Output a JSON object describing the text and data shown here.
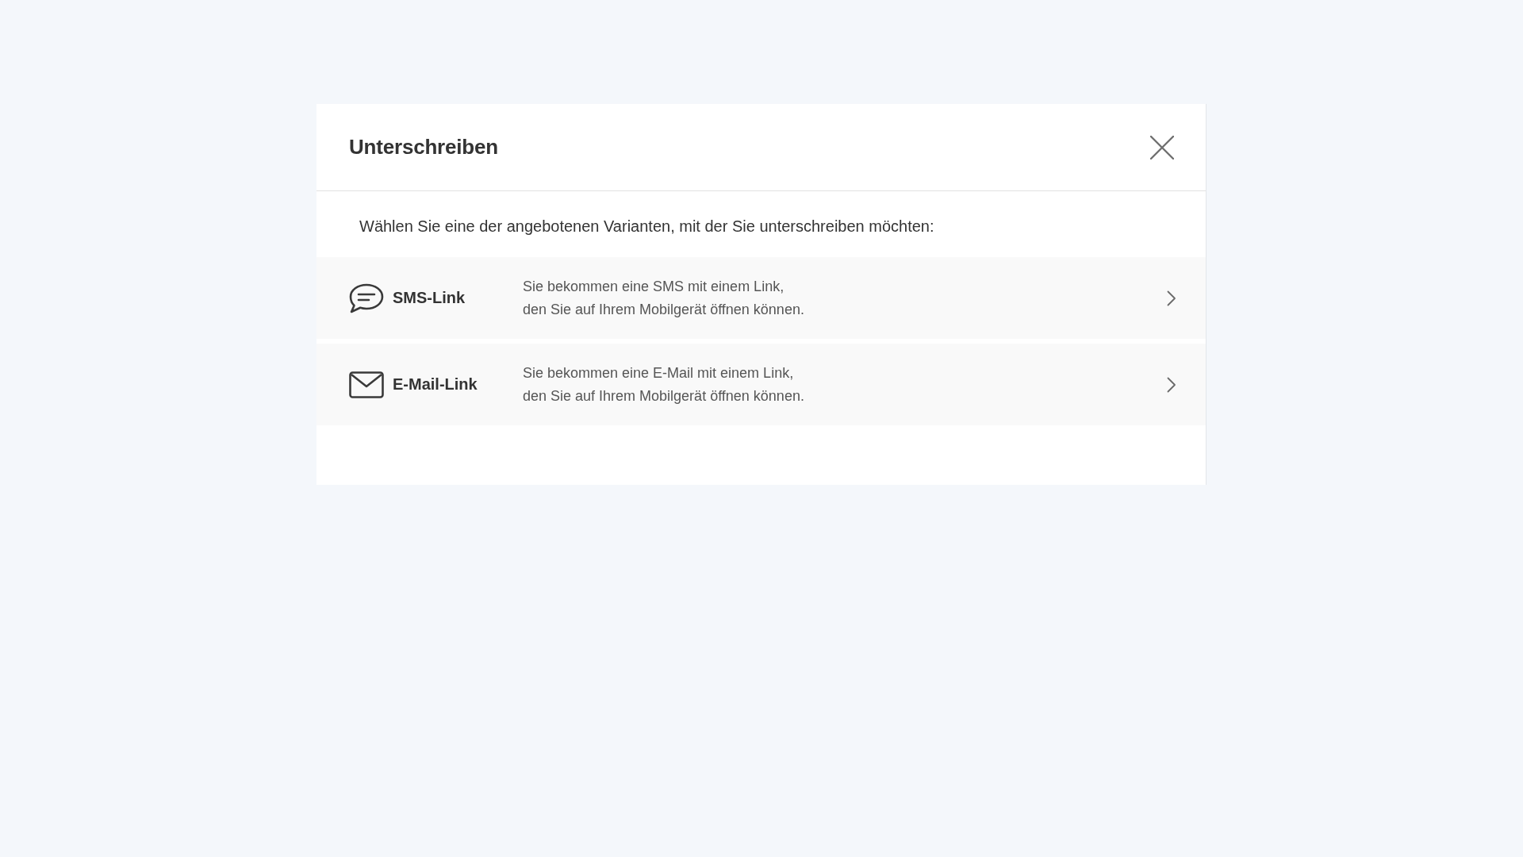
{
  "dialog": {
    "title": "Unterschreiben",
    "intro": "Wählen Sie eine der angebotenen Varianten, mit der Sie unterschreiben möchten:",
    "options": [
      {
        "kind": "sms",
        "label": "SMS-Link",
        "description": "Sie bekommen eine SMS mit einem Link,\nden Sie auf Ihrem Mobilgerät öffnen können."
      },
      {
        "kind": "email",
        "label": "E-Mail-Link",
        "description": "Sie bekommen eine E-Mail mit einem Link,\nden Sie auf Ihrem Mobilgerät öffnen können."
      }
    ]
  }
}
